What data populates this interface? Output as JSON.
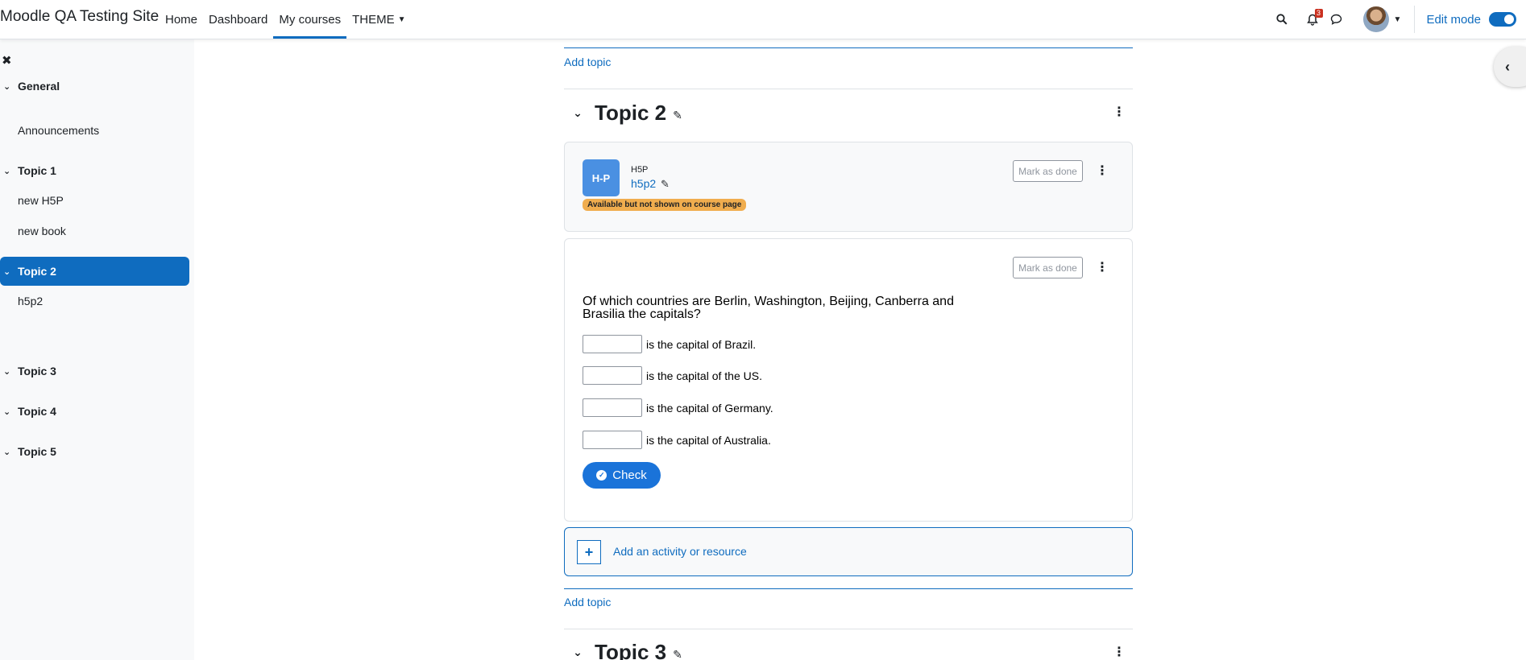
{
  "navbar": {
    "brand": "Moodle QA Testing Site",
    "links": [
      {
        "label": "Home"
      },
      {
        "label": "Dashboard"
      },
      {
        "label": "My courses"
      },
      {
        "label": "THEME"
      }
    ],
    "notification_count": "3",
    "edit_mode_label": "Edit mode"
  },
  "drawer": {
    "sections": [
      {
        "label": "General",
        "items": [
          "Announcements"
        ]
      },
      {
        "label": "Topic 1",
        "items": [
          "new H5P",
          "new book"
        ]
      },
      {
        "label": "Topic 2",
        "items": [
          "h5p2"
        ]
      },
      {
        "label": "Topic 3",
        "items": []
      },
      {
        "label": "Topic 4",
        "items": []
      },
      {
        "label": "Topic 5",
        "items": []
      }
    ]
  },
  "main": {
    "add_topic_label": "Add topic",
    "topic2": {
      "title": "Topic 2",
      "activity": {
        "icon_text": "H-P",
        "type": "H5P",
        "name": "h5p2",
        "badge": "Available but not shown on course page",
        "mark_done": "Mark as done"
      },
      "h5p_content": {
        "mark_done": "Mark as done",
        "question": "Of which countries are Berlin, Washington, Beijing, Canberra and Brasilia the capitals?",
        "blanks": [
          "is the capital of Brazil.",
          "is the capital of the US.",
          "is the capital of Germany.",
          "is the capital of Australia."
        ],
        "check_label": "Check"
      },
      "add_activity_label": "Add an activity or resource"
    },
    "topic3": {
      "title": "Topic 3"
    }
  }
}
